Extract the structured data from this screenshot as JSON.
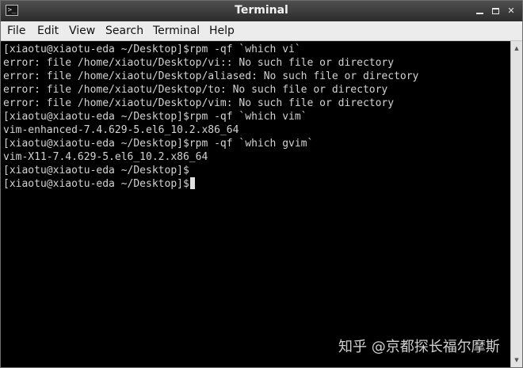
{
  "window": {
    "title": "Terminal",
    "app_icon_glyph": ">_"
  },
  "menu": [
    {
      "label": "File"
    },
    {
      "label": "Edit"
    },
    {
      "label": "View"
    },
    {
      "label": "Search"
    },
    {
      "label": "Terminal"
    },
    {
      "label": "Help"
    }
  ],
  "terminal": {
    "lines": [
      "[xiaotu@xiaotu-eda ~/Desktop]$rpm -qf `which vi`",
      "error: file /home/xiaotu/Desktop/vi:: No such file or directory",
      "error: file /home/xiaotu/Desktop/aliased: No such file or directory",
      "error: file /home/xiaotu/Desktop/to: No such file or directory",
      "error: file /home/xiaotu/Desktop/vim: No such file or directory",
      "[xiaotu@xiaotu-eda ~/Desktop]$rpm -qf `which vim`",
      "vim-enhanced-7.4.629-5.el6_10.2.x86_64",
      "[xiaotu@xiaotu-eda ~/Desktop]$rpm -qf `which gvim`",
      "vim-X11-7.4.629-5.el6_10.2.x86_64",
      "[xiaotu@xiaotu-eda ~/Desktop]$",
      "[xiaotu@xiaotu-eda ~/Desktop]$"
    ]
  },
  "watermark": "知乎 @京都探长福尔摩斯",
  "colors": {
    "terminal_bg": "#000000",
    "terminal_fg": "#d3d3d3",
    "titlebar": "#3a3a3a",
    "menubar": "#ececec"
  }
}
